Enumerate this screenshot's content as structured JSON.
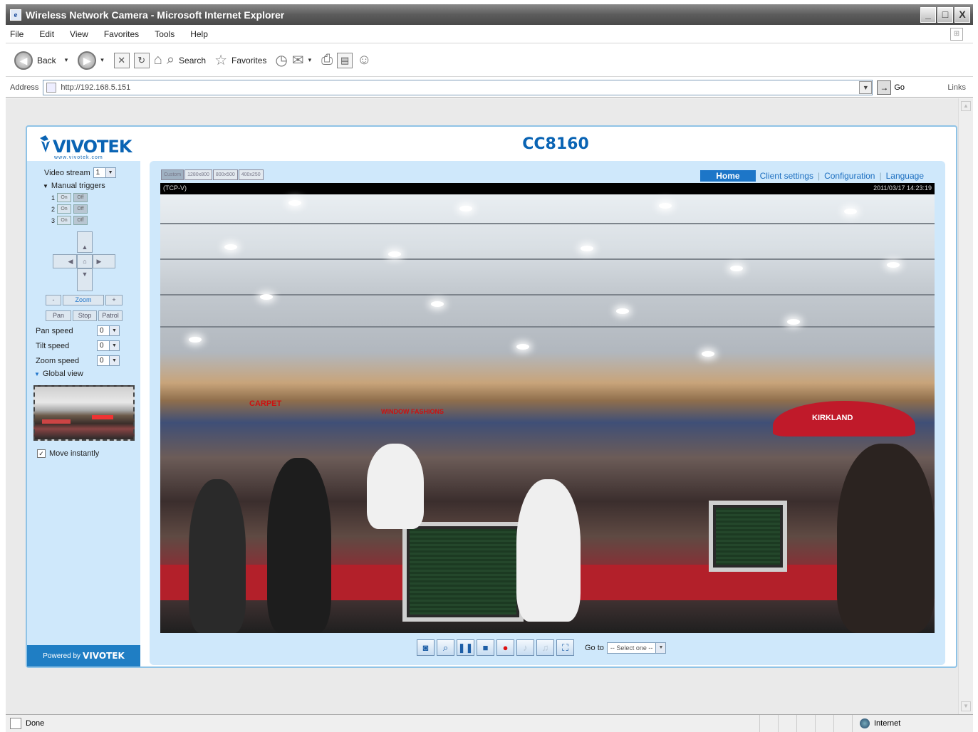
{
  "window": {
    "title": "Wireless Network Camera - Microsoft Internet Explorer",
    "buttons": {
      "minimize": "_",
      "maximize": "□",
      "close": "X"
    }
  },
  "menu": {
    "items": [
      "File",
      "Edit",
      "View",
      "Favorites",
      "Tools",
      "Help"
    ]
  },
  "toolbar": {
    "back": "Back",
    "search": "Search",
    "favorites": "Favorites"
  },
  "address": {
    "label": "Address",
    "value": "http://192.168.5.151",
    "go": "Go",
    "links": "Links"
  },
  "camera": {
    "brand": "VIVOTEK",
    "slogan": "www.vivotek.com",
    "model": "CC8160",
    "powered_by": "Powered by",
    "powered_brand": "VIVOTEK"
  },
  "left_panel": {
    "video_stream_label": "Video stream",
    "video_stream_value": "1",
    "manual_triggers_label": "Manual triggers",
    "triggers": [
      {
        "num": "1",
        "on": "On",
        "off": "Off"
      },
      {
        "num": "2",
        "on": "On",
        "off": "Off"
      },
      {
        "num": "3",
        "on": "On",
        "off": "Off"
      }
    ],
    "zoom_label": "Zoom",
    "zoom_minus": "-",
    "zoom_plus": "+",
    "pan_btn": "Pan",
    "stop_btn": "Stop",
    "patrol_btn": "Patrol",
    "pan_speed_label": "Pan speed",
    "pan_speed_value": "0",
    "tilt_speed_label": "Tilt speed",
    "tilt_speed_value": "0",
    "zoom_speed_label": "Zoom speed",
    "zoom_speed_value": "0",
    "global_view_label": "Global view",
    "move_instantly_label": "Move instantly",
    "move_instantly_checked": "✓"
  },
  "size_buttons": [
    "Custom",
    "1280x800",
    "800x500",
    "400x250"
  ],
  "nav": {
    "home": "Home",
    "client_settings": "Client settings",
    "configuration": "Configuration",
    "language": "Language"
  },
  "video": {
    "protocol": "(TCP-V)",
    "timestamp": "2011/03/17 14:23:19",
    "signs": {
      "carpet": "CARPET",
      "window_fashions": "WINDOW FASHIONS",
      "kirkland": "KIRKLAND"
    }
  },
  "controls": {
    "goto_label": "Go to",
    "goto_value": "-- Select one --"
  },
  "status": {
    "text": "Done",
    "zone": "Internet"
  }
}
